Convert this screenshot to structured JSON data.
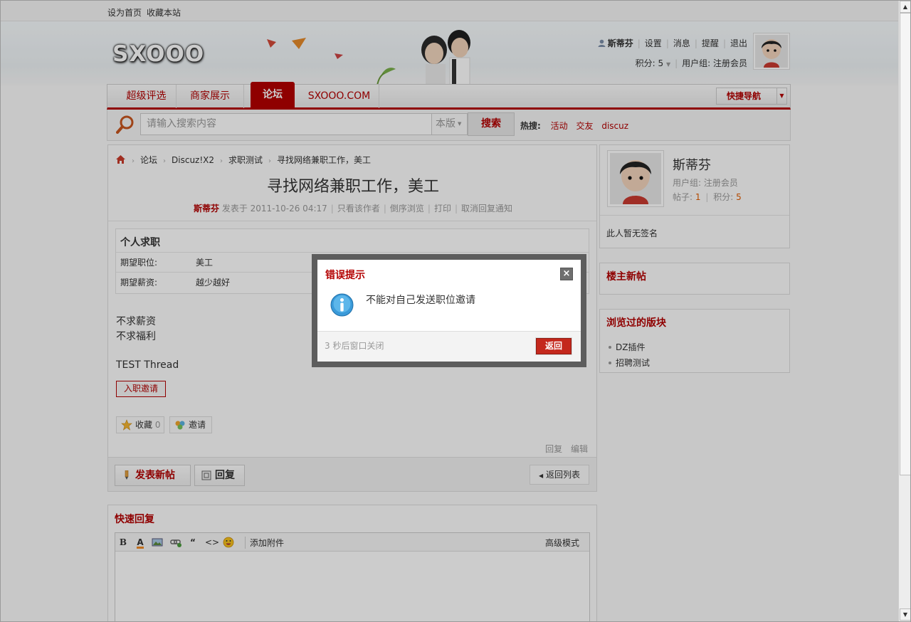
{
  "topbar": {
    "set_home": "设为首页",
    "bookmark": "收藏本站"
  },
  "header": {
    "logo": "SXOOO",
    "user": {
      "name": "斯蒂芬",
      "settings": "设置",
      "messages": "消息",
      "reminders": "提醒",
      "logout": "退出"
    },
    "points_label": "积分: 5",
    "usergroup_label": "用户组: 注册会员"
  },
  "nav": {
    "items": [
      "超级评选",
      "商家展示",
      "论坛",
      "SXOOO.COM"
    ],
    "active": "论坛",
    "quick_nav": "快捷导航"
  },
  "search": {
    "placeholder": "请输入搜索内容",
    "scope": "本版",
    "button": "搜索",
    "hot_label": "热搜:",
    "hot_terms": [
      "活动",
      "交友",
      "discuz"
    ]
  },
  "breadcrumb": [
    "论坛",
    "Discuz!X2",
    "求职测试",
    "寻找网络兼职工作，美工"
  ],
  "post": {
    "title": "寻找网络兼职工作，美工",
    "author": "斯蒂芬",
    "posted_at": "发表于 2011-10-26 04:17",
    "meta_links": [
      "只看该作者",
      "倒序浏览",
      "打印",
      "取消回复通知"
    ],
    "job": {
      "title": "个人求职",
      "rows": [
        {
          "key": "期望职位:",
          "value": "美工"
        },
        {
          "key": "期望薪资:",
          "value": "越少越好"
        }
      ]
    },
    "content_lines": [
      "不求薪资",
      "不求福利"
    ],
    "extra_line": "TEST Thread",
    "invite_button": "入职邀请",
    "favorite": {
      "label": "收藏",
      "count": "0"
    },
    "share_invite": "邀请",
    "ops": [
      "回复",
      "编辑"
    ],
    "new_thread": "发表新帖",
    "reply": "回复",
    "back_to_list": "返回列表"
  },
  "quick_reply": {
    "title": "快速回复",
    "attach": "添加附件",
    "advanced": "高级模式"
  },
  "sidebar": {
    "name": "斯蒂芬",
    "group": "用户组: 注册会员",
    "posts_label": "帖子:",
    "posts": "1",
    "points_label": "积分:",
    "points": "5",
    "signature": "此人暂无签名",
    "owner_new_title": "楼主新帖",
    "browsed_title": "浏览过的版块",
    "browsed": [
      "DZ插件",
      "招聘测试"
    ]
  },
  "dialog": {
    "title": "错误提示",
    "message": "不能对自己发送职位邀请",
    "countdown": "3 秒后窗口关闭",
    "back": "返回"
  },
  "colors": {
    "brand_red": "#b30000",
    "dialog_button": "#c4281d",
    "accent_orange": "#e05b00"
  }
}
